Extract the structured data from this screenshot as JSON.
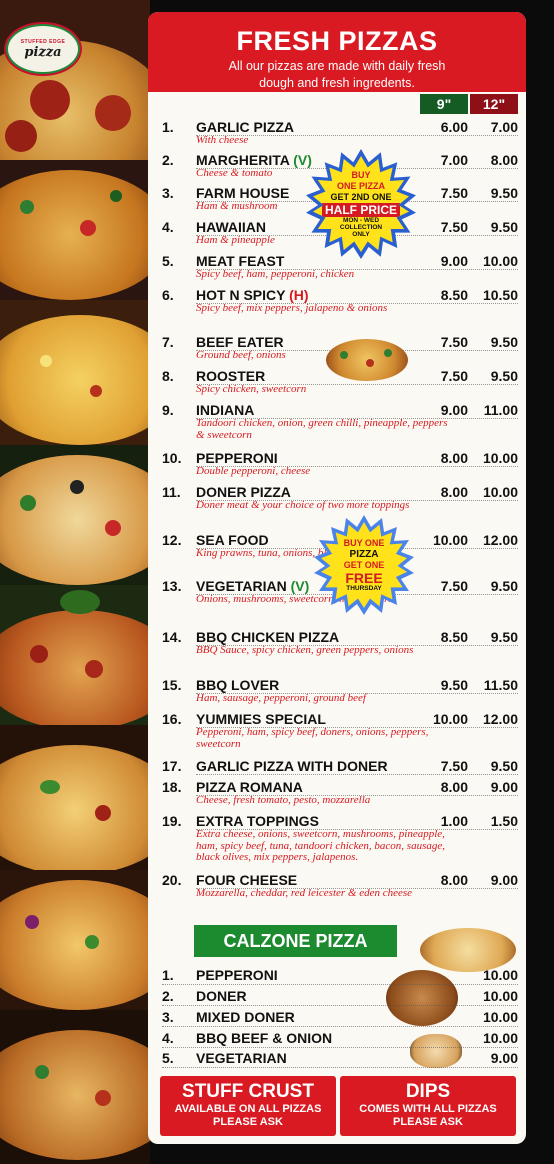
{
  "header": {
    "title": "FRESH PIZZAS",
    "subtitle_line1": "All our pizzas are made with daily fresh",
    "subtitle_line2": "dough and fresh ingredents."
  },
  "sizes": {
    "small": "9\"",
    "large": "12\""
  },
  "logo": {
    "text": "pizza",
    "ring": "STUFFED EDGE"
  },
  "pizzas": [
    {
      "num": "1.",
      "name": "GARLIC PIZZA",
      "tag": "",
      "tag_color": "",
      "desc": "With cheese",
      "p9": "6.00",
      "p12": "7.00"
    },
    {
      "num": "2.",
      "name": "MARGHERITA",
      "tag": "(V)",
      "tag_color": "#1c8a2f",
      "desc": "Cheese & tomato",
      "p9": "7.00",
      "p12": "8.00"
    },
    {
      "num": "3.",
      "name": "FARM HOUSE",
      "tag": "",
      "tag_color": "",
      "desc": "Ham & mushroom",
      "p9": "7.50",
      "p12": "9.50"
    },
    {
      "num": "4.",
      "name": "HAWAIIAN",
      "tag": "",
      "tag_color": "",
      "desc": "Ham & pineapple",
      "p9": "7.50",
      "p12": "9.50"
    },
    {
      "num": "5.",
      "name": "MEAT FEAST",
      "tag": "",
      "tag_color": "",
      "desc": "Spicy beef, ham, pepperoni, chicken",
      "p9": "9.00",
      "p12": "10.00"
    },
    {
      "num": "6.",
      "name": "HOT N SPICY",
      "tag": "(H)",
      "tag_color": "#d51a22",
      "desc": "Spicy beef, mix peppers, jalapeno & onions",
      "p9": "8.50",
      "p12": "10.50"
    },
    {
      "num": "7.",
      "name": "BEEF EATER",
      "tag": "",
      "tag_color": "",
      "desc": "Ground beef, onions",
      "p9": "7.50",
      "p12": "9.50"
    },
    {
      "num": "8.",
      "name": "ROOSTER",
      "tag": "",
      "tag_color": "",
      "desc": "Spicy chicken, sweetcorn",
      "p9": "7.50",
      "p12": "9.50"
    },
    {
      "num": "9.",
      "name": "INDIANA",
      "tag": "",
      "tag_color": "",
      "desc": "Tandoori chicken, onion, green chilli, pineapple, peppers & sweetcorn",
      "p9": "9.00",
      "p12": "11.00"
    },
    {
      "num": "10.",
      "name": "PEPPERONI",
      "tag": "",
      "tag_color": "",
      "desc": "Double pepperoni, cheese",
      "p9": "8.00",
      "p12": "10.00"
    },
    {
      "num": "11.",
      "name": "DONER PIZZA",
      "tag": "",
      "tag_color": "",
      "desc": "Doner meat & your choice of two more toppings",
      "p9": "8.00",
      "p12": "10.00"
    },
    {
      "num": "12.",
      "name": "SEA FOOD",
      "tag": "",
      "tag_color": "",
      "desc": "King prawns, tuna, onions, black olives",
      "p9": "10.00",
      "p12": "12.00"
    },
    {
      "num": "13.",
      "name": "VEGETARIAN",
      "tag": "(V)",
      "tag_color": "#1c8a2f",
      "desc": "Onions, mushrooms, sweetcorn, mix peppers",
      "p9": "7.50",
      "p12": "9.50"
    },
    {
      "num": "14.",
      "name": "BBQ CHICKEN PIZZA",
      "tag": "",
      "tag_color": "",
      "desc": "BBQ Sauce, spicy chicken, green peppers, onions",
      "p9": "8.50",
      "p12": "9.50"
    },
    {
      "num": "15.",
      "name": "BBQ LOVER",
      "tag": "",
      "tag_color": "",
      "desc": "Ham, sausage, pepperoni, ground beef",
      "p9": "9.50",
      "p12": "11.50"
    },
    {
      "num": "16.",
      "name": "YUMMIES SPECIAL",
      "tag": "",
      "tag_color": "",
      "desc": "Pepperoni, ham, spicy beef, doners, onions, peppers, sweetcorn",
      "p9": "10.00",
      "p12": "12.00"
    },
    {
      "num": "17.",
      "name": "GARLIC PIZZA WITH DONER",
      "tag": "",
      "tag_color": "",
      "desc": "",
      "p9": "7.50",
      "p12": "9.50"
    },
    {
      "num": "18.",
      "name": "PIZZA ROMANA",
      "tag": "",
      "tag_color": "",
      "desc": "Cheese, fresh tomato, pesto, mozzarella",
      "p9": "8.00",
      "p12": "9.00"
    },
    {
      "num": "19.",
      "name": "EXTRA TOPPINGS",
      "tag": "",
      "tag_color": "",
      "desc": "Extra cheese, onions, sweetcorn, mushrooms, pineapple, ham, spicy beef, tuna, tandoori chicken, bacon, sausage, black olives, mix peppers, jalapenos.",
      "p9": "1.00",
      "p12": "1.50"
    },
    {
      "num": "20.",
      "name": "FOUR CHEESE",
      "tag": "",
      "tag_color": "",
      "desc": "Mozzarella, cheddar, red leicester & eden cheese",
      "p9": "8.00",
      "p12": "9.00"
    }
  ],
  "promo1": {
    "l1": "BUY",
    "l2": "ONE PIZZA",
    "l3": "GET 2ND ONE",
    "l4": "HALF PRICE",
    "l5": "MON - WED",
    "l6": "COLLECTION",
    "l7": "ONLY"
  },
  "promo2": {
    "l1": "BUY ONE",
    "l2": "PIZZA",
    "l3": "GET ONE",
    "l4": "FREE",
    "l5": "THURSDAY"
  },
  "calzone": {
    "title": "CALZONE PIZZA",
    "items": [
      {
        "num": "1.",
        "name": "PEPPERONI",
        "price": "10.00"
      },
      {
        "num": "2.",
        "name": "DONER",
        "price": "10.00"
      },
      {
        "num": "3.",
        "name": "MIXED DONER",
        "price": "10.00"
      },
      {
        "num": "4.",
        "name": "BBQ BEEF & ONION",
        "price": "10.00"
      },
      {
        "num": "5.",
        "name": "VEGETARIAN",
        "price": "9.00"
      }
    ]
  },
  "stuff_crust": {
    "title": "STUFF CRUST",
    "line1": "AVAILABLE ON ALL PIZZAS",
    "line2": "PLEASE ASK"
  },
  "dips": {
    "title": "DIPS",
    "line1": "COMES WITH ALL PIZZAS",
    "line2": "PLEASE ASK"
  },
  "colors": {
    "red": "#d91a22",
    "green": "#1c8a2f",
    "dark_green": "#155c24",
    "dark_red": "#8e1016",
    "cream": "#fbf9f3"
  }
}
